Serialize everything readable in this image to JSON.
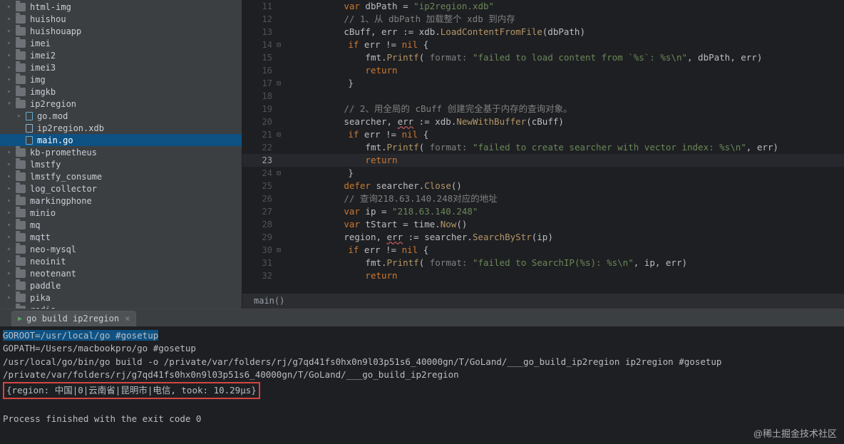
{
  "sidebar": {
    "items": [
      {
        "label": "html-img",
        "type": "folder",
        "depth": 0
      },
      {
        "label": "huishou",
        "type": "folder",
        "depth": 0
      },
      {
        "label": "huishouapp",
        "type": "folder",
        "depth": 0
      },
      {
        "label": "imei",
        "type": "folder",
        "depth": 0
      },
      {
        "label": "imei2",
        "type": "folder",
        "depth": 0
      },
      {
        "label": "imei3",
        "type": "folder",
        "depth": 0
      },
      {
        "label": "img",
        "type": "folder",
        "depth": 0
      },
      {
        "label": "imgkb",
        "type": "folder",
        "depth": 0
      },
      {
        "label": "ip2region",
        "type": "folder",
        "depth": 0,
        "open": true
      },
      {
        "label": "go.mod",
        "type": "file-go",
        "depth": 1,
        "expandable": true
      },
      {
        "label": "ip2region.xdb",
        "type": "file",
        "depth": 1
      },
      {
        "label": "main.go",
        "type": "file-go",
        "depth": 1,
        "selected": true
      },
      {
        "label": "kb-prometheus",
        "type": "folder",
        "depth": 0
      },
      {
        "label": "lmstfy",
        "type": "folder",
        "depth": 0
      },
      {
        "label": "lmstfy_consume",
        "type": "folder",
        "depth": 0
      },
      {
        "label": "log_collector",
        "type": "folder",
        "depth": 0
      },
      {
        "label": "markingphone",
        "type": "folder",
        "depth": 0
      },
      {
        "label": "minio",
        "type": "folder",
        "depth": 0
      },
      {
        "label": "mq",
        "type": "folder",
        "depth": 0
      },
      {
        "label": "mqtt",
        "type": "folder",
        "depth": 0
      },
      {
        "label": "neo-mysql",
        "type": "folder",
        "depth": 0
      },
      {
        "label": "neoinit",
        "type": "folder",
        "depth": 0
      },
      {
        "label": "neotenant",
        "type": "folder",
        "depth": 0
      },
      {
        "label": "paddle",
        "type": "folder",
        "depth": 0
      },
      {
        "label": "pika",
        "type": "folder",
        "depth": 0
      },
      {
        "label": "redis",
        "type": "folder",
        "depth": 0
      }
    ]
  },
  "editor": {
    "first_line": 11,
    "current_line": 23,
    "lines": [
      {
        "n": 11,
        "col": 3,
        "seg": [
          [
            "kw",
            "var"
          ],
          [
            "",
            " dbPath = "
          ],
          [
            "str",
            "\"ip2region.xdb\""
          ]
        ]
      },
      {
        "n": 12,
        "col": 3,
        "seg": [
          [
            "com",
            "// 1、从 dbPath 加载整个 xdb 到内存"
          ]
        ]
      },
      {
        "n": 13,
        "col": 3,
        "seg": [
          [
            "",
            "cBuff, err := xdb."
          ],
          [
            "fn",
            "LoadContentFromFile"
          ],
          [
            "",
            "(dbPath)"
          ]
        ]
      },
      {
        "n": 14,
        "col": 3,
        "fold": "-",
        "seg": [
          [
            "kw",
            "if"
          ],
          [
            "",
            " err != "
          ],
          [
            "kw",
            "nil"
          ],
          [
            "",
            " {"
          ]
        ]
      },
      {
        "n": 15,
        "col": 4,
        "seg": [
          [
            "",
            "fmt."
          ],
          [
            "fn",
            "Printf"
          ],
          [
            "",
            "( "
          ],
          [
            "cm",
            "format:"
          ],
          [
            "",
            " "
          ],
          [
            "str",
            "\"failed to load content from `%s`: %s\\n\""
          ],
          [
            "",
            ", dbPath, err)"
          ]
        ]
      },
      {
        "n": 16,
        "col": 4,
        "seg": [
          [
            "kw",
            "return"
          ]
        ]
      },
      {
        "n": 17,
        "col": 3,
        "fold": "-",
        "seg": [
          [
            "",
            "}"
          ]
        ]
      },
      {
        "n": 18,
        "col": 3,
        "seg": [
          [
            "",
            ""
          ]
        ]
      },
      {
        "n": 19,
        "col": 3,
        "seg": [
          [
            "com",
            "// 2、用全局的 cBuff 创建完全基于内存的查询对象。"
          ]
        ]
      },
      {
        "n": 20,
        "col": 3,
        "seg": [
          [
            "",
            "searcher, "
          ],
          [
            "err",
            "err"
          ],
          [
            "",
            " := xdb."
          ],
          [
            "fn",
            "NewWithBuffer"
          ],
          [
            "",
            "(cBuff)"
          ]
        ]
      },
      {
        "n": 21,
        "col": 3,
        "fold": "-",
        "seg": [
          [
            "kw",
            "if"
          ],
          [
            "",
            " err != "
          ],
          [
            "kw",
            "nil"
          ],
          [
            "",
            " {"
          ]
        ]
      },
      {
        "n": 22,
        "col": 4,
        "seg": [
          [
            "",
            "fmt."
          ],
          [
            "fn",
            "Printf"
          ],
          [
            "",
            "( "
          ],
          [
            "cm",
            "format:"
          ],
          [
            "",
            " "
          ],
          [
            "str",
            "\"failed to create searcher with vector index: %s\\n\""
          ],
          [
            "",
            ", err)"
          ]
        ]
      },
      {
        "n": 23,
        "col": 4,
        "current": true,
        "seg": [
          [
            "kw",
            "return"
          ]
        ]
      },
      {
        "n": 24,
        "col": 3,
        "fold": "-",
        "seg": [
          [
            "",
            "}"
          ]
        ]
      },
      {
        "n": 25,
        "col": 3,
        "seg": [
          [
            "kw",
            "defer"
          ],
          [
            "",
            " searcher."
          ],
          [
            "fn",
            "Close"
          ],
          [
            "",
            "()"
          ]
        ]
      },
      {
        "n": 26,
        "col": 3,
        "seg": [
          [
            "com",
            "// 查询218.63.140.248对应的地址"
          ]
        ]
      },
      {
        "n": 27,
        "col": 3,
        "seg": [
          [
            "kw",
            "var"
          ],
          [
            "",
            " ip = "
          ],
          [
            "str",
            "\"218.63.140.248\""
          ]
        ]
      },
      {
        "n": 28,
        "col": 3,
        "seg": [
          [
            "kw",
            "var"
          ],
          [
            "",
            " tStart = time."
          ],
          [
            "fn",
            "Now"
          ],
          [
            "",
            "()"
          ]
        ]
      },
      {
        "n": 29,
        "col": 3,
        "seg": [
          [
            "",
            "region, "
          ],
          [
            "err",
            "err"
          ],
          [
            "",
            " := searcher."
          ],
          [
            "fn",
            "SearchByStr"
          ],
          [
            "",
            "(ip)"
          ]
        ]
      },
      {
        "n": 30,
        "col": 3,
        "fold": "-",
        "seg": [
          [
            "kw",
            "if"
          ],
          [
            "",
            " err != "
          ],
          [
            "kw",
            "nil"
          ],
          [
            "",
            " {"
          ]
        ]
      },
      {
        "n": 31,
        "col": 4,
        "seg": [
          [
            "",
            "fmt."
          ],
          [
            "fn",
            "Printf"
          ],
          [
            "",
            "( "
          ],
          [
            "cm",
            "format:"
          ],
          [
            "",
            " "
          ],
          [
            "str",
            "\"failed to SearchIP(%s): %s\\n\""
          ],
          [
            "",
            ", ip, err)"
          ]
        ]
      },
      {
        "n": 32,
        "col": 4,
        "seg": [
          [
            "kw",
            "return"
          ]
        ]
      }
    ],
    "breadcrumb": "main()"
  },
  "run": {
    "tab_label": "go build ip2region",
    "lines": [
      {
        "text": "GOROOT=/usr/local/go #gosetup",
        "sel": true
      },
      {
        "text": "GOPATH=/Users/macbookpro/go #gosetup"
      },
      {
        "text": "/usr/local/go/bin/go build -o /private/var/folders/rj/g7qd41fs0hx0n9l03p51s6_40000gn/T/GoLand/___go_build_ip2region ip2region #gosetup"
      },
      {
        "text": "/private/var/folders/rj/g7qd41fs0hx0n9l03p51s6_40000gn/T/GoLand/___go_build_ip2region"
      }
    ],
    "highlight": "{region: 中国|0|云南省|昆明市|电信, took: 10.29µs}",
    "exit": "Process finished with the exit code 0"
  },
  "watermark": "@稀土掘金技术社区"
}
